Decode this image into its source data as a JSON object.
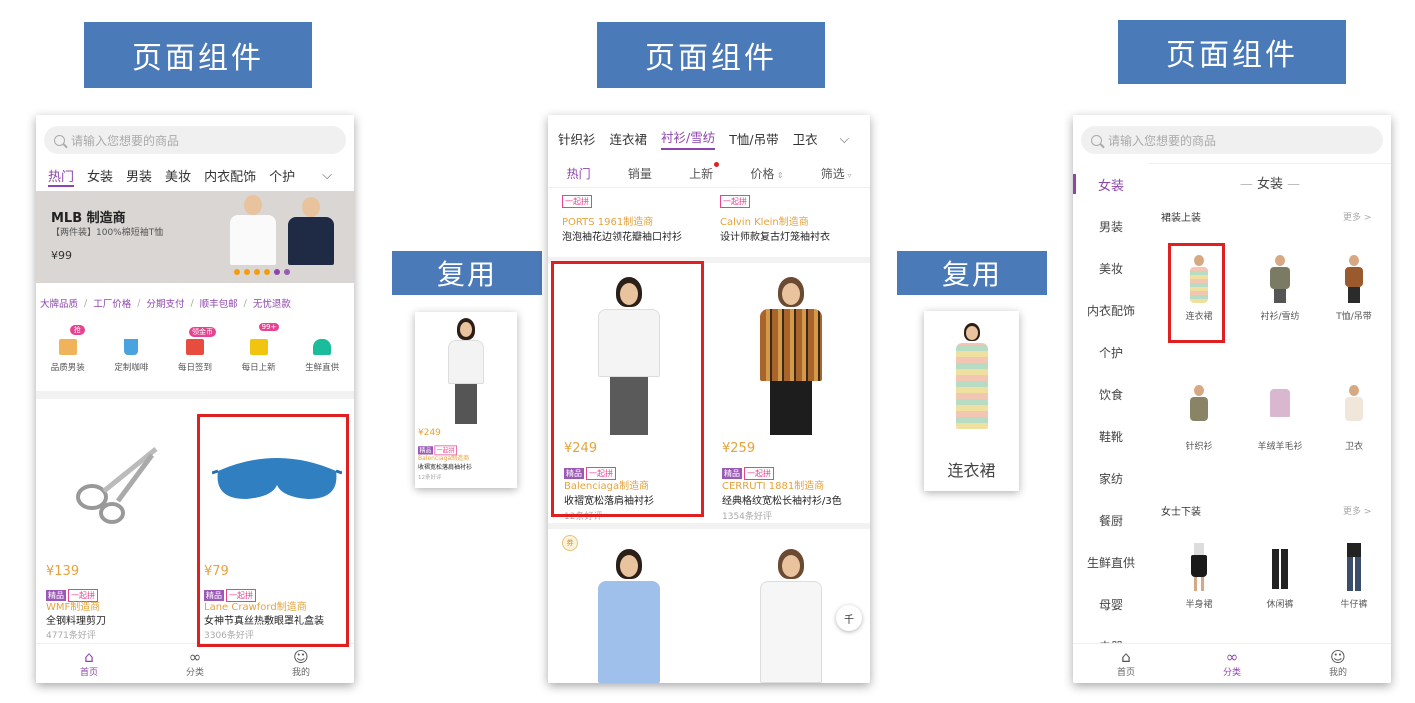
{
  "section_titles": [
    "页面组件",
    "页面组件",
    "页面组件"
  ],
  "reuse_labels": [
    "复用",
    "复用"
  ],
  "phone1": {
    "search_placeholder": "请输入您想要的商品",
    "nav": [
      "热门",
      "女装",
      "男装",
      "美妆",
      "内衣配饰",
      "个护"
    ],
    "banner": {
      "title": "MLB 制造商",
      "subtitle": "【两件装】100%棉短袖T恤",
      "price": "¥99"
    },
    "features": [
      "大牌品质",
      "/",
      "工厂价格",
      "/",
      "分期支付",
      "/",
      "顺丰包邮",
      "/",
      "无忧退款"
    ],
    "icons": [
      {
        "label": "品质男装",
        "badge": "抢",
        "name": "quality-menswear-icon"
      },
      {
        "label": "定制咖啡",
        "badge": "",
        "name": "custom-coffee-icon"
      },
      {
        "label": "每日签到",
        "badge": "领金币",
        "name": "daily-checkin-icon"
      },
      {
        "label": "每日上新",
        "badge": "99+",
        "name": "daily-new-icon"
      },
      {
        "label": "生鲜直供",
        "badge": "",
        "name": "fresh-supply-icon"
      }
    ],
    "products": [
      {
        "price": "¥139",
        "tag1": "精品",
        "tag2": "一起拼",
        "brand": "WMF制造商",
        "name": "全钢料理剪刀",
        "reviews": "4771条好评"
      },
      {
        "price": "¥79",
        "tag1": "精品",
        "tag2": "一起拼",
        "brand": "Lane Crawford制造商",
        "name": "女神节真丝热敷眼罩礼盒装",
        "reviews": "3306条好评"
      }
    ],
    "tabbar": [
      "首页",
      "分类",
      "我的"
    ]
  },
  "card1": {
    "price": "¥249",
    "tag1": "精品",
    "tag2": "一起拼",
    "brand": "Balenciaga制造商",
    "name": "收褶宽松落肩袖衬衫",
    "reviews": "12条好评"
  },
  "phone2": {
    "categories": [
      "针织衫",
      "连衣裙",
      "衬衫/雪纺",
      "T恤/吊带",
      "卫衣"
    ],
    "sort": [
      "热门",
      "销量",
      "上新",
      "价格",
      "筛选"
    ],
    "top_items": [
      {
        "tag": "一起拼",
        "brand": "PORTS 1961制造商",
        "name": "泡泡袖花边领花瓣袖口衬衫"
      },
      {
        "tag": "一起拼",
        "brand": "Calvin Klein制造商",
        "name": "设计师款复古灯笼袖衬衣"
      }
    ],
    "products": [
      {
        "price": "¥249",
        "tag1": "精品",
        "tag2": "一起拼",
        "brand": "Balenciaga制造商",
        "name": "收褶宽松落肩袖衬衫",
        "reviews": "12条好评"
      },
      {
        "price": "¥259",
        "tag1": "精品",
        "tag2": "一起拼",
        "brand": "CERRUTI 1881制造商",
        "name": "经典格纹宽松长袖衬衫/3色",
        "reviews": "1354条好评"
      }
    ],
    "scroll_top": "千"
  },
  "card2": {
    "label": "连衣裙"
  },
  "phone3": {
    "search_placeholder": "请输入您想要的商品",
    "sidebar": [
      "女装",
      "男装",
      "美妆",
      "内衣配饰",
      "个护",
      "饮食",
      "鞋靴",
      "家纺",
      "餐厨",
      "生鲜直供",
      "母婴",
      "电器"
    ],
    "header": "女装",
    "sec1": {
      "title": "裙装上装",
      "more": "更多 >"
    },
    "grid1": [
      "连衣裙",
      "衬衫/雪纺",
      "T恤/吊带",
      "针织衫",
      "羊绒羊毛衫",
      "卫衣"
    ],
    "sec2": {
      "title": "女士下装",
      "more": "更多 >"
    },
    "grid2": [
      "半身裙",
      "休闲裤",
      "牛仔裤"
    ],
    "tabbar": [
      "首页",
      "分类",
      "我的"
    ]
  },
  "colors": {
    "accent": "#8e44ad",
    "title_bg": "#4b7ab8",
    "highlight": "#e02020",
    "price": "#e6a23c"
  }
}
